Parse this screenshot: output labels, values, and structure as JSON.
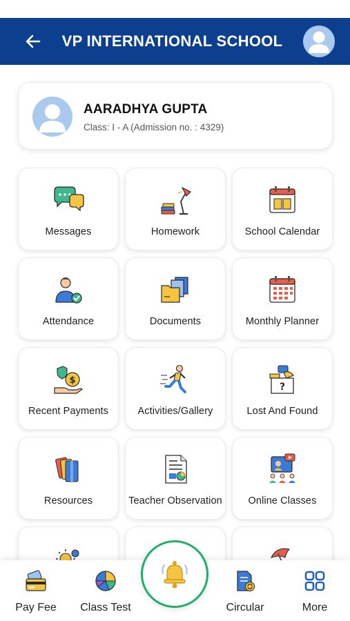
{
  "header": {
    "title": "VP INTERNATIONAL SCHOOL",
    "back_icon": "arrow-left-icon",
    "avatar_icon": "user-avatar-icon"
  },
  "student": {
    "name": "AARADHYA GUPTA",
    "class_info": "Class: I - A (Admission no. : 4329)"
  },
  "tiles": [
    {
      "label": "Messages",
      "icon": "chat-bubbles-icon"
    },
    {
      "label": "Homework",
      "icon": "desk-lamp-books-icon"
    },
    {
      "label": "School Calendar",
      "icon": "calendar-book-icon"
    },
    {
      "label": "Attendance",
      "icon": "person-check-icon"
    },
    {
      "label": "Documents",
      "icon": "folders-icon"
    },
    {
      "label": "Monthly Planner",
      "icon": "calendar-grid-icon"
    },
    {
      "label": "Recent Payments",
      "icon": "hand-money-icon"
    },
    {
      "label": "Activities/Gallery",
      "icon": "runner-icon"
    },
    {
      "label": "Lost And Found",
      "icon": "box-question-icon"
    },
    {
      "label": "Resources",
      "icon": "stacked-books-icon"
    },
    {
      "label": "Teacher Observation",
      "icon": "report-chart-icon"
    },
    {
      "label": "Online Classes",
      "icon": "video-class-icon"
    }
  ],
  "bottom_nav": [
    {
      "label": "Pay Fee",
      "icon": "credit-card-icon"
    },
    {
      "label": "Class Test",
      "icon": "pie-chart-icon"
    },
    {
      "label": "Circular",
      "icon": "document-sync-icon"
    },
    {
      "label": "More",
      "icon": "grid-icon"
    }
  ],
  "fab": {
    "icon": "bell-icon"
  },
  "colors": {
    "header_bg": "#0d3f8f",
    "fab_ring": "#1eaf6a",
    "avatar_bg": "#a9c9ee"
  }
}
